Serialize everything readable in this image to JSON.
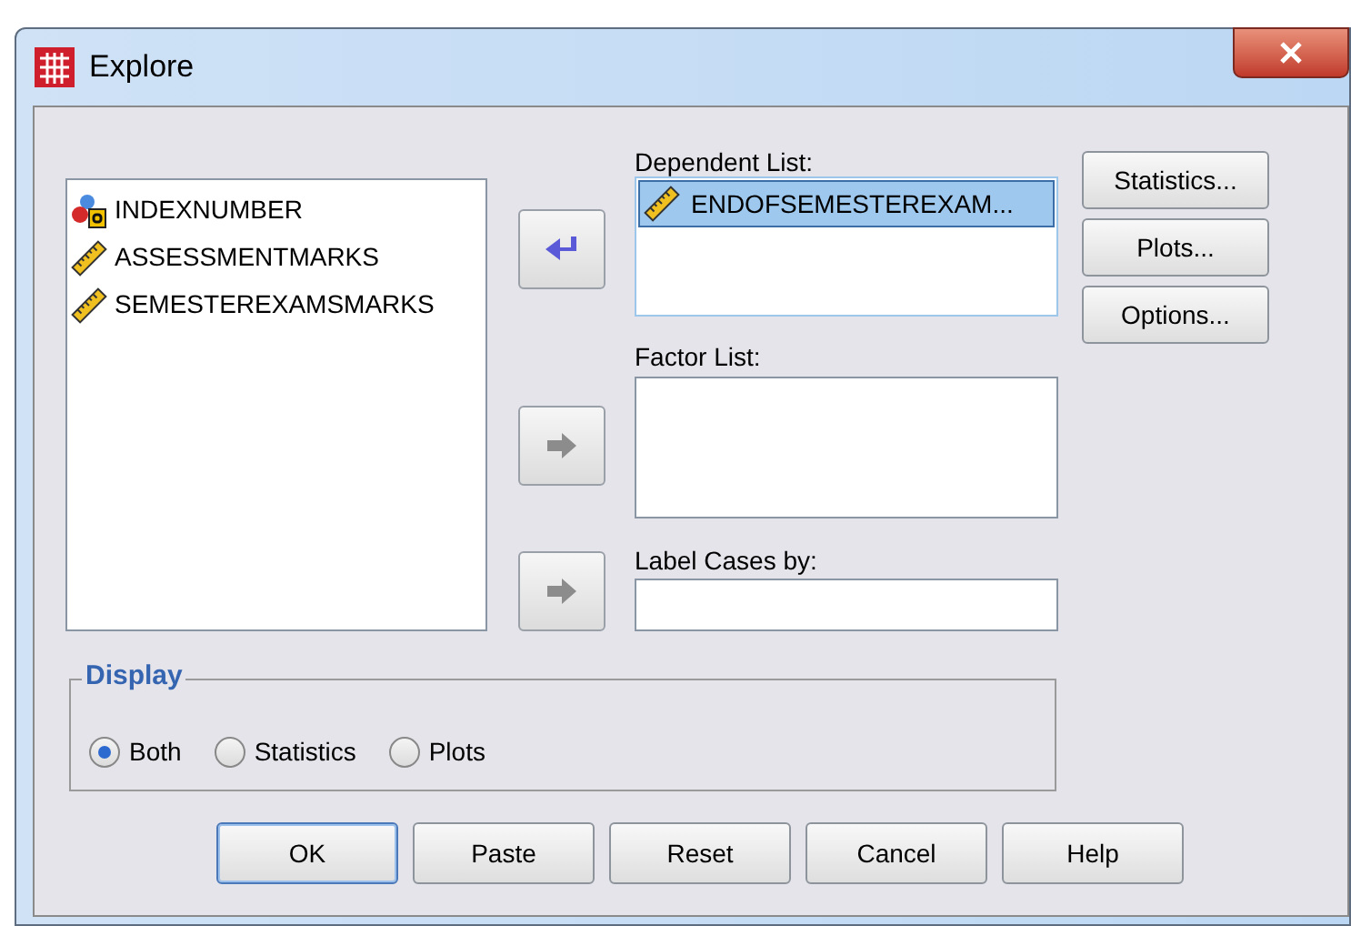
{
  "window": {
    "title": "Explore"
  },
  "variables": [
    {
      "name": "INDEXNUMBER",
      "kind": "nominal"
    },
    {
      "name": "ASSESSMENTMARKS",
      "kind": "scale"
    },
    {
      "name": "SEMESTEREXAMSMARKS",
      "kind": "scale"
    }
  ],
  "arrow_buttons": [
    {
      "disabled": false
    },
    {
      "disabled": true
    },
    {
      "disabled": true
    }
  ],
  "dependent_list": {
    "label": "Dependent List:",
    "items": [
      {
        "name": "ENDOFSEMESTEREXAM...",
        "kind": "scale",
        "selected": true
      }
    ]
  },
  "factor_list": {
    "label": "Factor List:"
  },
  "label_cases": {
    "label": "Label Cases by:"
  },
  "side_buttons": [
    "Statistics...",
    "Plots...",
    "Options..."
  ],
  "display": {
    "label": "Display",
    "options": [
      {
        "label": "Both",
        "selected": true
      },
      {
        "label": "Statistics",
        "selected": false
      },
      {
        "label": "Plots",
        "selected": false
      }
    ]
  },
  "buttons": [
    {
      "label": "OK",
      "default": true
    },
    {
      "label": "Paste",
      "default": false
    },
    {
      "label": "Reset",
      "default": false
    },
    {
      "label": "Cancel",
      "default": false
    },
    {
      "label": "Help",
      "default": false
    }
  ]
}
